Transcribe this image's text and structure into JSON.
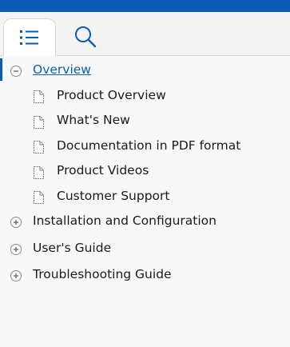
{
  "tabs": [
    {
      "name": "contents",
      "icon": "list-icon"
    },
    {
      "name": "search",
      "icon": "search-icon"
    }
  ],
  "tree": {
    "overview": {
      "label": "Overview",
      "expanded": true,
      "children": [
        "Product Overview",
        "What's New",
        "Documentation in PDF format",
        "Product Videos",
        "Customer Support"
      ]
    },
    "sections": [
      "Installation and Configuration",
      "User's Guide",
      "Troubleshooting Guide"
    ]
  },
  "colors": {
    "accent": "#0a5bb8",
    "link": "#0b5fb4"
  }
}
